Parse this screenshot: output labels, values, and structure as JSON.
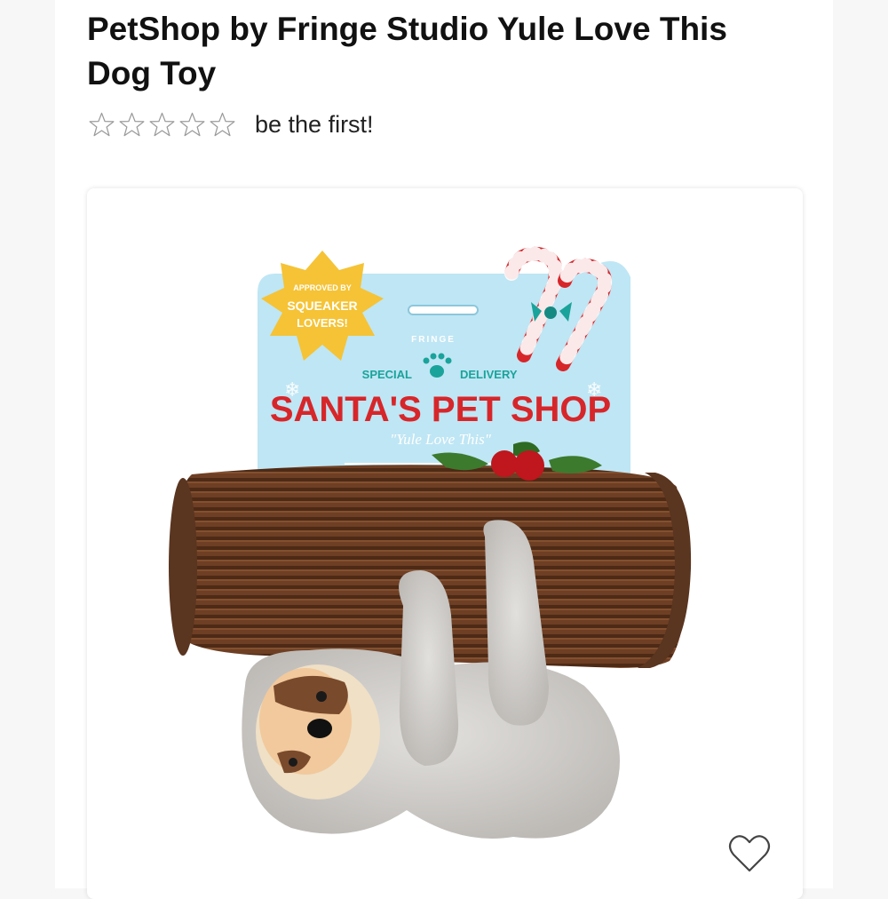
{
  "product": {
    "title": "PetShop by Fringe Studio Yule Love This Dog Toy",
    "rating": {
      "stars_filled": 0,
      "stars_total": 5,
      "text": "be the first!"
    }
  },
  "image": {
    "badge_text": [
      "APPROVED BY",
      "SQUEAKER",
      "LOVERS!"
    ],
    "brand": "FRINGE",
    "special_left": "SPECIAL",
    "special_right": "DELIVERY",
    "headline": "SANTA'S PET SHOP",
    "tagline": "\"Yule Love This\""
  },
  "colors": {
    "tag_blue": "#bfe6f4",
    "teal": "#1aa39a",
    "red": "#d7262a",
    "badge_yellow": "#f5c335",
    "log_brown": "#6e3f24",
    "star_outline": "#9a9a9a"
  },
  "icons": {
    "star": "star-outline-icon",
    "heart": "heart-outline-icon"
  }
}
